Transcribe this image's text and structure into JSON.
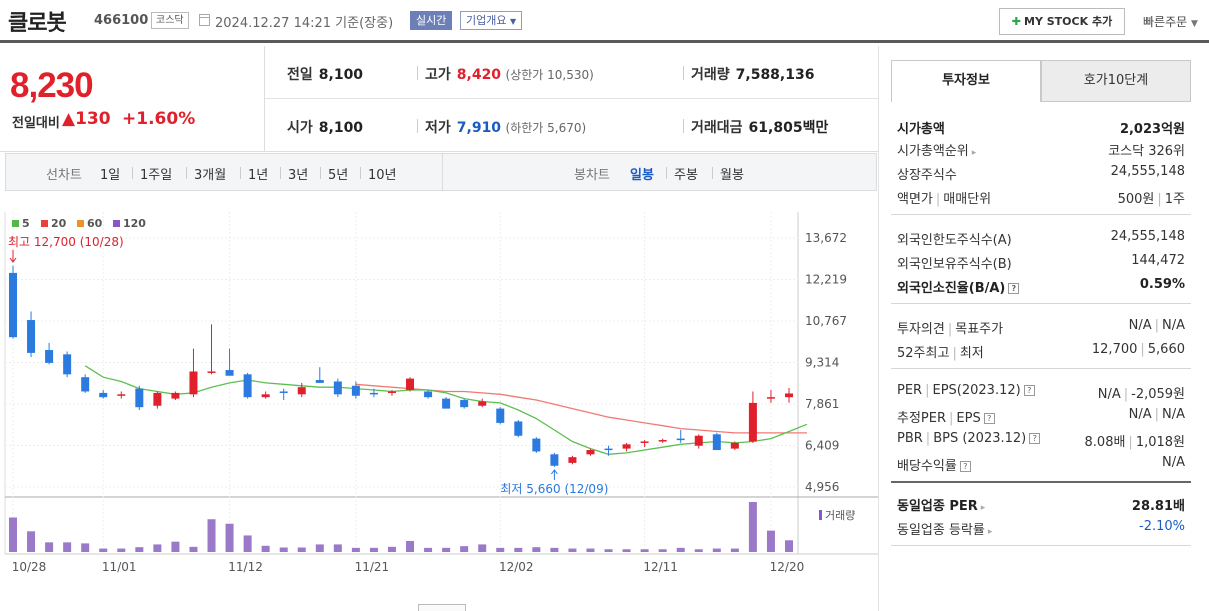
{
  "header": {
    "name": "클로봇",
    "code": "466100",
    "market": "코스닥",
    "datetime": "2024.12.27 14:21",
    "basis": "기준(장중)",
    "realtime": "실시간",
    "company_info": "기업개요",
    "mystock": "MY STOCK 추가",
    "quick_order": "빠른주문"
  },
  "price": {
    "current": "8,230",
    "prev_label": "전일대비",
    "change": "▲130",
    "change_pct": "+1.60%",
    "prev_close_label": "전일",
    "prev_close": "8,100",
    "high_label": "고가",
    "high": "8,420",
    "upper_limit_text": "(상한가 10,530)",
    "volume_label": "거래량",
    "volume": "7,588,136",
    "open_label": "시가",
    "open": "8,100",
    "low_label": "저가",
    "low": "7,910",
    "lower_limit_text": "(하한가 5,670)",
    "amount_label": "거래대금",
    "amount": "61,805",
    "amount_unit": "백만"
  },
  "period": {
    "line_label": "선차트",
    "line_items": [
      "1일",
      "1주일",
      "3개월",
      "1년",
      "3년",
      "5년",
      "10년"
    ],
    "candle_label": "봉차트",
    "candle_items": [
      "일봉",
      "주봉",
      "월봉"
    ],
    "active_candle": "일봉"
  },
  "chart_data": {
    "type": "candlestick",
    "legend": [
      {
        "name": "5",
        "color": "#52b84a"
      },
      {
        "name": "20",
        "color": "#e8413c"
      },
      {
        "name": "60",
        "color": "#f0902a"
      },
      {
        "name": "120",
        "color": "#8b55c9"
      }
    ],
    "y_ticks": [
      "13,672",
      "12,219",
      "10,767",
      "9,314",
      "7,861",
      "6,409",
      "4,956"
    ],
    "ylim": [
      4956,
      13672
    ],
    "x_labels": [
      {
        "i": 0,
        "label": "10/28"
      },
      {
        "i": 5,
        "label": "11/01"
      },
      {
        "i": 12,
        "label": "11/12"
      },
      {
        "i": 19,
        "label": "11/21"
      },
      {
        "i": 27,
        "label": "12/02"
      },
      {
        "i": 35,
        "label": "12/11"
      },
      {
        "i": 42,
        "label": "12/20"
      }
    ],
    "max_note": "최고 12,700 (10/28)",
    "min_note": "최저 5,660 (12/09)",
    "volume_label": "거래량",
    "up_color": "#e0212c",
    "down_color": "#2b7ae0",
    "candles": [
      {
        "o": 12450,
        "h": 12700,
        "l": 10150,
        "c": 10200
      },
      {
        "o": 10800,
        "h": 11100,
        "l": 9500,
        "c": 9650
      },
      {
        "o": 9750,
        "h": 10000,
        "l": 9250,
        "c": 9300
      },
      {
        "o": 9600,
        "h": 9700,
        "l": 8800,
        "c": 8900
      },
      {
        "o": 8800,
        "h": 8900,
        "l": 8250,
        "c": 8300
      },
      {
        "o": 8250,
        "h": 8350,
        "l": 8050,
        "c": 8100
      },
      {
        "o": 8150,
        "h": 8300,
        "l": 8050,
        "c": 8200
      },
      {
        "o": 8400,
        "h": 8500,
        "l": 7650,
        "c": 7750
      },
      {
        "o": 7800,
        "h": 8300,
        "l": 7700,
        "c": 8250
      },
      {
        "o": 8050,
        "h": 8300,
        "l": 8000,
        "c": 8250
      },
      {
        "o": 8200,
        "h": 9800,
        "l": 8100,
        "c": 9000
      },
      {
        "o": 9000,
        "h": 10650,
        "l": 8900,
        "c": 9000
      },
      {
        "o": 9050,
        "h": 9800,
        "l": 8900,
        "c": 8850
      },
      {
        "o": 8900,
        "h": 8950,
        "l": 8050,
        "c": 8100
      },
      {
        "o": 8100,
        "h": 8300,
        "l": 8050,
        "c": 8200
      },
      {
        "o": 8300,
        "h": 8400,
        "l": 8000,
        "c": 8250
      },
      {
        "o": 8200,
        "h": 8600,
        "l": 8100,
        "c": 8450
      },
      {
        "o": 8700,
        "h": 9150,
        "l": 8600,
        "c": 8600
      },
      {
        "o": 8650,
        "h": 8750,
        "l": 8100,
        "c": 8200
      },
      {
        "o": 8500,
        "h": 8650,
        "l": 8050,
        "c": 8150
      },
      {
        "o": 8250,
        "h": 8400,
        "l": 8100,
        "c": 8200
      },
      {
        "o": 8250,
        "h": 8350,
        "l": 8150,
        "c": 8300
      },
      {
        "o": 8350,
        "h": 8800,
        "l": 8300,
        "c": 8750
      },
      {
        "o": 8300,
        "h": 8350,
        "l": 8050,
        "c": 8100
      },
      {
        "o": 8050,
        "h": 8100,
        "l": 7700,
        "c": 7700
      },
      {
        "o": 8000,
        "h": 8050,
        "l": 7700,
        "c": 7750
      },
      {
        "o": 7800,
        "h": 8050,
        "l": 7750,
        "c": 7950
      },
      {
        "o": 7700,
        "h": 7750,
        "l": 7150,
        "c": 7200
      },
      {
        "o": 7250,
        "h": 7300,
        "l": 6700,
        "c": 6750
      },
      {
        "o": 6650,
        "h": 6700,
        "l": 6150,
        "c": 6200
      },
      {
        "o": 6100,
        "h": 6150,
        "l": 5660,
        "c": 5700
      },
      {
        "o": 5800,
        "h": 6050,
        "l": 5750,
        "c": 6000
      },
      {
        "o": 6100,
        "h": 6300,
        "l": 6050,
        "c": 6250
      },
      {
        "o": 6300,
        "h": 6400,
        "l": 6050,
        "c": 6250
      },
      {
        "o": 6300,
        "h": 6500,
        "l": 6200,
        "c": 6450
      },
      {
        "o": 6500,
        "h": 6600,
        "l": 6350,
        "c": 6550
      },
      {
        "o": 6550,
        "h": 6650,
        "l": 6500,
        "c": 6600
      },
      {
        "o": 6650,
        "h": 6950,
        "l": 6500,
        "c": 6600
      },
      {
        "o": 6400,
        "h": 6800,
        "l": 6300,
        "c": 6750
      },
      {
        "o": 6800,
        "h": 6850,
        "l": 6250,
        "c": 6250
      },
      {
        "o": 6300,
        "h": 6550,
        "l": 6250,
        "c": 6500
      },
      {
        "o": 6550,
        "h": 8300,
        "l": 6500,
        "c": 7900
      },
      {
        "o": 8100,
        "h": 8350,
        "l": 7900,
        "c": 8100
      },
      {
        "o": 8100,
        "h": 8420,
        "l": 7910,
        "c": 8230
      }
    ],
    "ma5": [
      null,
      null,
      null,
      null,
      9200,
      8800,
      8650,
      8400,
      8300,
      8200,
      8250,
      8450,
      8600,
      8700,
      8600,
      8550,
      8500,
      8450,
      8450,
      8400,
      8350,
      8300,
      8350,
      8350,
      8250,
      8050,
      7950,
      7900,
      7650,
      7350,
      6950,
      6550,
      6300,
      6100,
      6150,
      6250,
      6350,
      6450,
      6500,
      6550,
      6500,
      6550,
      6650,
      6900,
      7150
    ],
    "ma20": [
      null,
      null,
      null,
      null,
      null,
      null,
      null,
      null,
      null,
      null,
      null,
      null,
      null,
      null,
      null,
      null,
      null,
      null,
      null,
      8550,
      8500,
      8450,
      8400,
      8350,
      8300,
      8300,
      8250,
      8200,
      8100,
      8000,
      7850,
      7700,
      7550,
      7400,
      7300,
      7200,
      7100,
      7000,
      6950,
      6900,
      6850,
      6850,
      6850,
      6850,
      6850
    ],
    "volumes": [
      1.0,
      0.6,
      0.28,
      0.28,
      0.25,
      0.1,
      0.1,
      0.14,
      0.22,
      0.3,
      0.15,
      0.95,
      0.82,
      0.48,
      0.18,
      0.13,
      0.13,
      0.22,
      0.22,
      0.12,
      0.12,
      0.15,
      0.32,
      0.12,
      0.12,
      0.17,
      0.22,
      0.12,
      0.12,
      0.14,
      0.12,
      0.1,
      0.1,
      0.08,
      0.08,
      0.08,
      0.08,
      0.12,
      0.08,
      0.1,
      0.1,
      1.45,
      0.62,
      0.34
    ]
  },
  "side": {
    "tab_invest": "투자정보",
    "tab_orderbook": "호가10단계",
    "rows": {
      "market_cap": {
        "k": "시가총액",
        "v": "2,023억원"
      },
      "cap_rank": {
        "k": "시가총액순위",
        "v": "코스닥 326위"
      },
      "shares": {
        "k": "상장주식수",
        "v": "24,555,148"
      },
      "face": {
        "k1": "액면가",
        "k2": "매매단위",
        "v1": "500원",
        "v2": "1주"
      },
      "foreign_limit": {
        "k": "외국인한도주식수(A)",
        "v": "24,555,148"
      },
      "foreign_hold": {
        "k": "외국인보유주식수(B)",
        "v": "144,472"
      },
      "foreign_ratio": {
        "k": "외국인소진율(B/A)",
        "v": "0.59%"
      },
      "opinion": {
        "k1": "투자의견",
        "k2": "목표주가",
        "v1": "N/A",
        "v2": "N/A"
      },
      "w52": {
        "k1": "52주최고",
        "k2": "최저",
        "v1": "12,700",
        "v2": "5,660"
      },
      "per": {
        "k1": "PER",
        "k2": "EPS(2023.12)",
        "v1": "N/A",
        "v2": "-2,059원"
      },
      "eper": {
        "k1": "추정PER",
        "k2": "EPS",
        "v1": "N/A",
        "v2": "N/A"
      },
      "pbr": {
        "k1": "PBR",
        "k2": "BPS (2023.12)",
        "v1": "8.08배",
        "v2": "1,018원"
      },
      "div": {
        "k": "배당수익률",
        "v": "N/A"
      },
      "sector_per": {
        "k": "동일업종 PER",
        "v": "28.81배"
      },
      "sector_rate": {
        "k": "동일업종 등락률",
        "v": "-2.10%"
      }
    }
  }
}
